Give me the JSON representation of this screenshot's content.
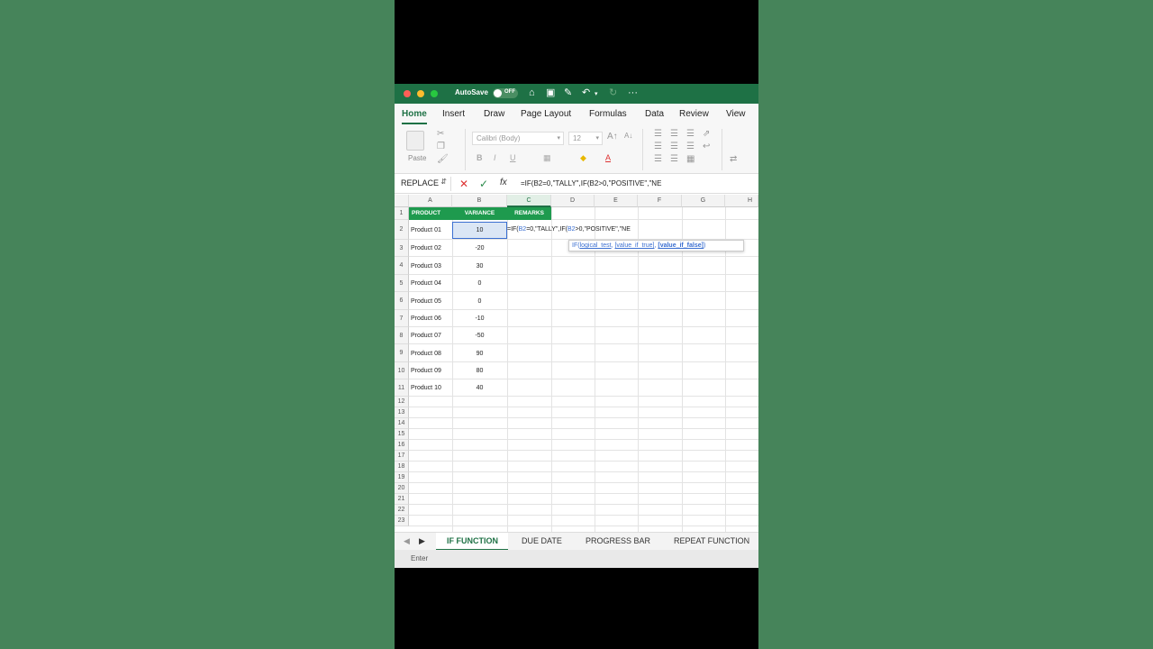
{
  "titlebar": {
    "autosave_label": "AutoSave",
    "autosave_state": "OFF",
    "more_label": "···"
  },
  "ribbon_tabs": [
    "Home",
    "Insert",
    "Draw",
    "Page Layout",
    "Formulas",
    "Data",
    "Review",
    "View"
  ],
  "ribbon": {
    "paste_label": "Paste",
    "font_name": "Calibri (Body)",
    "font_size": "12",
    "bold": "B",
    "italic": "I",
    "underline": "U"
  },
  "formula_bar": {
    "name_box": "REPLACE",
    "formula": "=IF(B2=0,\"TALLY\",IF(B2>0,\"POSITIVE\",\"NE"
  },
  "columns": [
    "A",
    "B",
    "C",
    "D",
    "E",
    "F",
    "G",
    "H"
  ],
  "rows": [
    "1",
    "2",
    "3",
    "4",
    "5",
    "6",
    "7",
    "8",
    "9",
    "10",
    "11",
    "12",
    "13",
    "14",
    "15",
    "16",
    "17",
    "18",
    "19",
    "20",
    "21",
    "22",
    "23"
  ],
  "table": {
    "headers": [
      "PRODUCT",
      "VARIANCE",
      "REMARKS"
    ],
    "products": [
      "Product 01",
      "Product 02",
      "Product 03",
      "Product 04",
      "Product 05",
      "Product 06",
      "Product 07",
      "Product 08",
      "Product 09",
      "Product 10"
    ],
    "variances": [
      "10",
      "-20",
      "30",
      "0",
      "0",
      "-10",
      "-50",
      "90",
      "80",
      "40"
    ]
  },
  "edit_cell": {
    "prefix": "=IF(",
    "ref1": "B2",
    "mid": "=0,\"TALLY\",IF(",
    "ref2": "B2",
    "suffix": ">0,\"POSITIVE\",\"NE"
  },
  "tooltip": {
    "fn": "IF(",
    "arg1": "logical_test",
    "sep1": ", ",
    "arg2": "[value_if_true]",
    "sep2": ", ",
    "arg3": "[value_if_false]",
    "close": ")"
  },
  "sheet_tabs": [
    "IF FUNCTION",
    "DUE DATE",
    "PROGRESS BAR",
    "REPEAT FUNCTION"
  ],
  "status": "Enter",
  "colors": {
    "excel_green": "#1e7145",
    "header_fill": "#1e9a4e",
    "background_green": "#46845a"
  }
}
